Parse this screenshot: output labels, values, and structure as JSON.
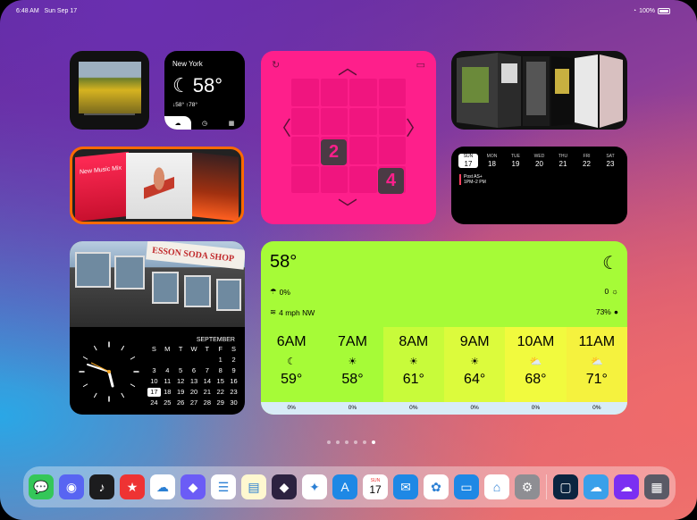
{
  "status_bar": {
    "time": "6:48 AM",
    "date": "Sun Sep 17",
    "battery": "100%"
  },
  "weather_small": {
    "city": "New York",
    "temp": "58°",
    "low": "↓58°",
    "high": "↑78°"
  },
  "game": {
    "tile_a": "2",
    "tile_b": "4"
  },
  "week_calendar": {
    "days": [
      {
        "name": "SUN",
        "num": "17"
      },
      {
        "name": "MON",
        "num": "18"
      },
      {
        "name": "TUE",
        "num": "19"
      },
      {
        "name": "WED",
        "num": "20"
      },
      {
        "name": "THU",
        "num": "21"
      },
      {
        "name": "FRI",
        "num": "22"
      },
      {
        "name": "SAT",
        "num": "23"
      }
    ],
    "event_title": "Post AS+",
    "event_time": "1PM–2 PM"
  },
  "music": {
    "playlist": "New Music Mix"
  },
  "photo_sign": "ESSON SODA SHOP",
  "month_calendar": {
    "month": "SEPTEMBER",
    "headers": [
      "S",
      "M",
      "T",
      "W",
      "T",
      "F",
      "S"
    ],
    "cells": [
      "",
      "",
      "",
      "",
      "",
      "1",
      "2",
      "3",
      "4",
      "5",
      "6",
      "7",
      "8",
      "9",
      "10",
      "11",
      "12",
      "13",
      "14",
      "15",
      "16",
      "17",
      "18",
      "19",
      "20",
      "21",
      "22",
      "23",
      "24",
      "25",
      "26",
      "27",
      "28",
      "29",
      "30"
    ]
  },
  "weather_big": {
    "now": "58°",
    "precip_chance": "0%",
    "uv": "0",
    "wind": "4 mph NW",
    "humidity": "73%",
    "hours": [
      {
        "time": "6AM",
        "temp": "59°",
        "precip": "0%",
        "icon": "moon-icon",
        "color": "#a6fb37"
      },
      {
        "time": "7AM",
        "temp": "58°",
        "precip": "0%",
        "icon": "sun-icon",
        "color": "#a6fb37"
      },
      {
        "time": "8AM",
        "temp": "61°",
        "precip": "0%",
        "icon": "sun-icon",
        "color": "#c8fb3a"
      },
      {
        "time": "9AM",
        "temp": "64°",
        "precip": "0%",
        "icon": "sun-icon",
        "color": "#dcfb3c"
      },
      {
        "time": "10AM",
        "temp": "68°",
        "precip": "0%",
        "icon": "partly-cloudy-icon",
        "color": "#f1fa3e"
      },
      {
        "time": "11AM",
        "temp": "71°",
        "precip": "0%",
        "icon": "partly-cloudy-icon",
        "color": "#f5f23e"
      }
    ]
  },
  "dock": {
    "apps": [
      {
        "name": "messages",
        "color": "#34c759",
        "glyph": "💬"
      },
      {
        "name": "discord",
        "color": "#5865f2",
        "glyph": "◉"
      },
      {
        "name": "music",
        "color": "#1c1c1e",
        "glyph": "♪"
      },
      {
        "name": "news",
        "color": "#e33",
        "glyph": "★"
      },
      {
        "name": "icloud",
        "color": "#ffffff",
        "glyph": "☁"
      },
      {
        "name": "shortcuts",
        "color": "#6b5cf6",
        "glyph": "◆"
      },
      {
        "name": "reminders",
        "color": "#ffffff",
        "glyph": "☰"
      },
      {
        "name": "notes",
        "color": "#fff8d0",
        "glyph": "▤"
      },
      {
        "name": "obsidian",
        "color": "#2c2240",
        "glyph": "◆"
      },
      {
        "name": "safari",
        "color": "#ffffff",
        "glyph": "✦"
      },
      {
        "name": "app-store",
        "color": "#1e88e5",
        "glyph": "A"
      },
      {
        "name": "calendar",
        "color": "#ffffff",
        "glyph": ""
      },
      {
        "name": "mail",
        "color": "#1e88e5",
        "glyph": "✉"
      },
      {
        "name": "photos",
        "color": "#ffffff",
        "glyph": "✿"
      },
      {
        "name": "files",
        "color": "#1e88e5",
        "glyph": "▭"
      },
      {
        "name": "home",
        "color": "#ffffff",
        "glyph": "⌂"
      },
      {
        "name": "settings",
        "color": "#8e8e93",
        "glyph": "⚙"
      }
    ],
    "calendar_day": "SUN",
    "calendar_num": "17",
    "recent": [
      {
        "name": "recent-app-1",
        "color": "#0b2540",
        "glyph": "▢"
      },
      {
        "name": "recent-app-2",
        "color": "#3aa0ea",
        "glyph": "☁"
      },
      {
        "name": "recent-app-3",
        "color": "#7b2ff2",
        "glyph": "☁"
      },
      {
        "name": "app-library",
        "color": "#5a5a66",
        "glyph": "▦"
      }
    ]
  }
}
